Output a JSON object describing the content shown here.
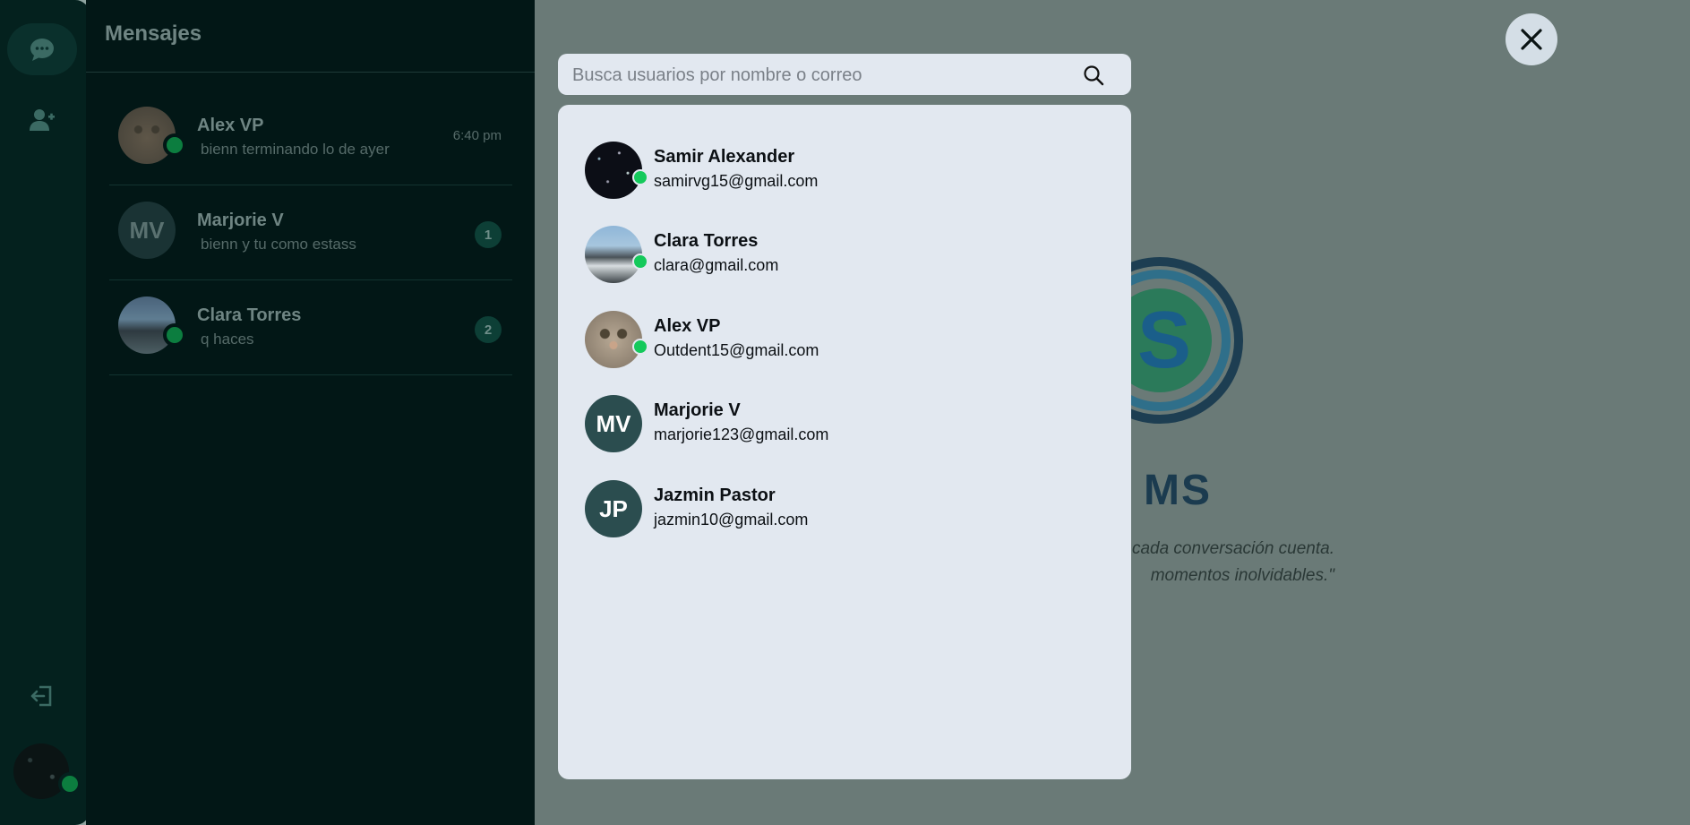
{
  "sidebar": {
    "items": [
      {
        "icon": "chat-bubble-icon",
        "active": true
      },
      {
        "icon": "add-user-icon",
        "active": false
      }
    ],
    "logout_icon": "logout-icon",
    "profile_icon": "profile-avatar"
  },
  "chat_panel": {
    "title": "Mensajes",
    "chats": [
      {
        "name": "Alex VP",
        "preview": "bienn terminando lo de ayer",
        "time": "6:40 pm",
        "unread": null,
        "online": true,
        "avatar": "cat"
      },
      {
        "name": "Marjorie V",
        "preview": "bienn y tu como estass",
        "time": null,
        "unread": "1",
        "online": false,
        "avatar": "initials",
        "initials": "MV"
      },
      {
        "name": "Clara Torres",
        "preview": "q haces",
        "time": null,
        "unread": "2",
        "online": true,
        "avatar": "beach"
      }
    ]
  },
  "main": {
    "logo_text": "MS",
    "tagline_line1": "cada conversación cuenta.",
    "tagline_line2": "momentos inolvidables.\""
  },
  "modal": {
    "search_placeholder": "Busca usuarios por nombre o correo",
    "search_value": "",
    "users": [
      {
        "name": "Samir Alexander",
        "email": "samirvg15@gmail.com",
        "online": true,
        "avatar": "space"
      },
      {
        "name": "Clara Torres",
        "email": "clara@gmail.com",
        "online": true,
        "avatar": "beach"
      },
      {
        "name": "Alex VP",
        "email": "Outdent15@gmail.com",
        "online": true,
        "avatar": "cat"
      },
      {
        "name": "Marjorie V",
        "email": "marjorie123@gmail.com",
        "online": false,
        "avatar": "initials",
        "initials": "MV"
      },
      {
        "name": "Jazmin Pastor",
        "email": "jazmin10@gmail.com",
        "online": false,
        "avatar": "initials",
        "initials": "JP"
      }
    ]
  },
  "colors": {
    "online": "#14c95b",
    "initials_avatar": "#2b4d4f",
    "panel_bg": "#021716",
    "overlay": "#6a7a77"
  }
}
